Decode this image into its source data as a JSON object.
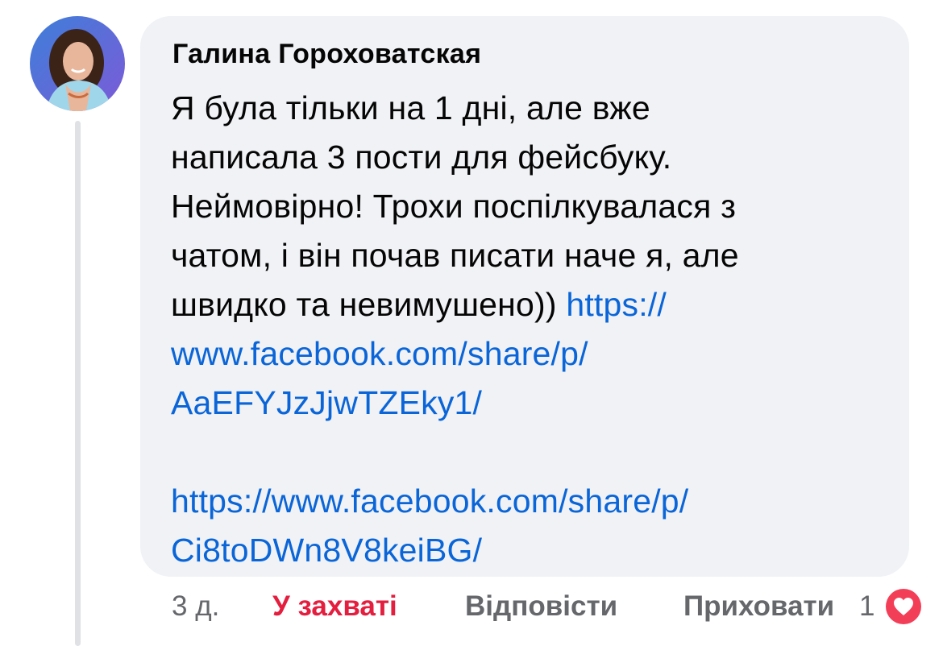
{
  "comment": {
    "author": "Галина Гороховатская",
    "avatar_icon": "user-avatar",
    "text_lines": [
      "Я була тільки на 1 дні, але вже",
      "написала 3 пости для фейсбуку.",
      "Неймовірно! Трохи поспілкувалася з",
      "чатом, і він почав писати наче я, але",
      "швидко та невимушено)) "
    ],
    "link1_lines": [
      "https://",
      "www.facebook.com/share/p/",
      "AaEFYJzJjwTZEky1/"
    ],
    "link2_lines": [
      "https://www.facebook.com/share/p/",
      "Ci8toDWn8V8keiBG/"
    ]
  },
  "actions": {
    "time": "3 д.",
    "liked_label": "У захваті",
    "reply_label": "Відповісти",
    "hide_label": "Приховати",
    "reaction_count": "1",
    "reaction_icon": "love-heart-icon"
  },
  "colors": {
    "link": "#0a65d8",
    "reaction": "#e41e3f",
    "bubble": "#f0f2f5",
    "muted": "#65676b"
  }
}
